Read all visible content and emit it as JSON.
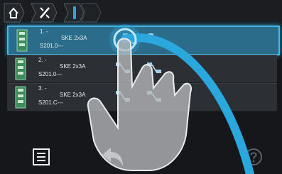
{
  "breadcrumb": {
    "icons": [
      "home-icon",
      "tools-icon",
      "separator-icon",
      "current-level-icon"
    ]
  },
  "list": {
    "rows": [
      {
        "number": "1. -",
        "name": "SKE 2x3A",
        "code": "S201.0---",
        "selected": true
      },
      {
        "number": "2. -",
        "name": "SKE 2x3A",
        "code": "S201.0---",
        "selected": false
      },
      {
        "number": "3. -",
        "name": "SKE 2x3A",
        "code": "S201.C---",
        "selected": false
      }
    ]
  },
  "toolbar": {
    "list_icon": "list-icon",
    "back_icon": "back-arrow-icon",
    "help_icon": "help-icon"
  },
  "colors": {
    "accent": "#2aa7dc",
    "selected_row": "#2b6c8a",
    "row": "#2c2f33",
    "background": "#15171a"
  }
}
